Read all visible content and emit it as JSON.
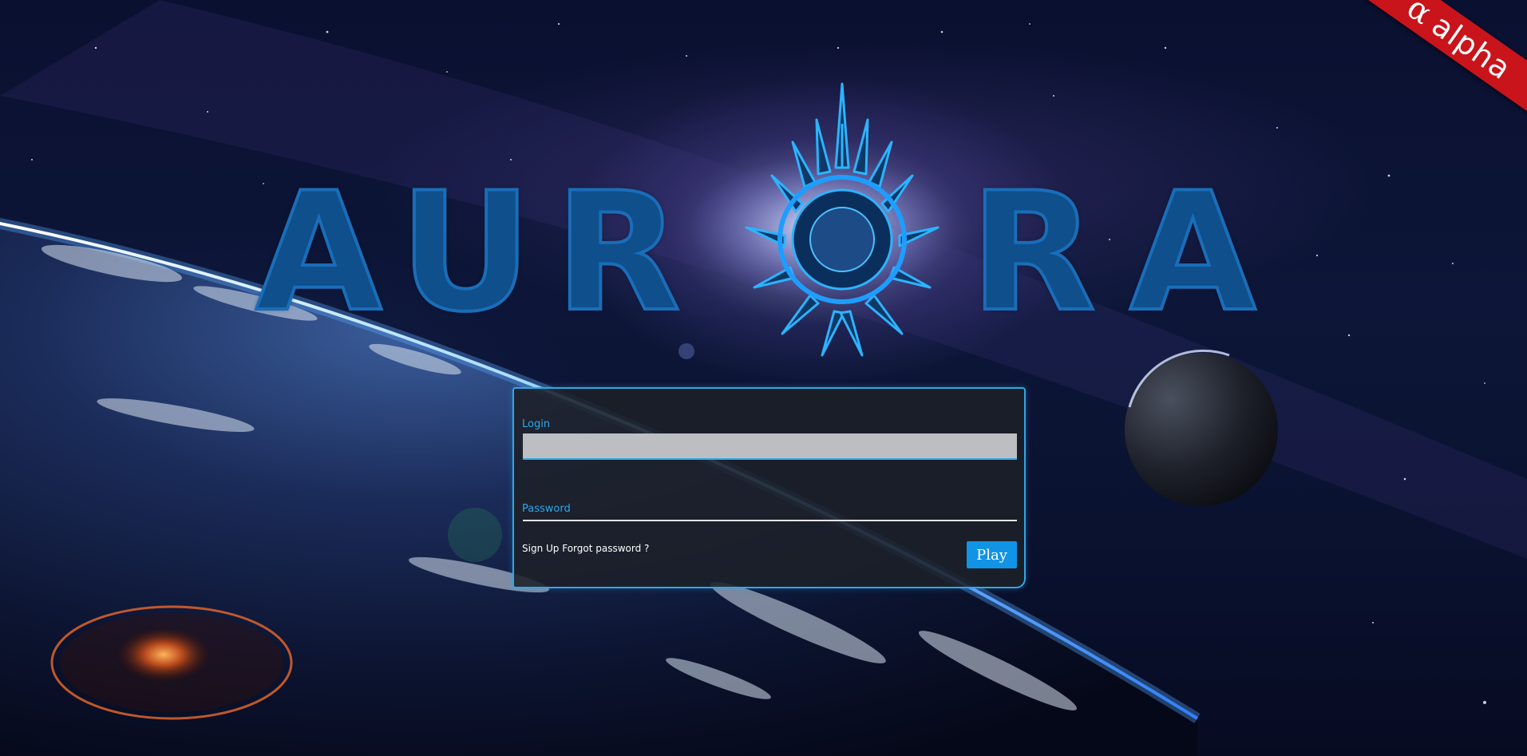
{
  "badge": {
    "alpha_symbol": "α",
    "alpha_text": "alpha"
  },
  "logo": {
    "letters_left": [
      "A",
      "U",
      "R"
    ],
    "letters_right": [
      "R",
      "A"
    ]
  },
  "login_form": {
    "login_label": "Login",
    "login_value": "",
    "password_label": "Password",
    "password_value": "",
    "signup_link": "Sign Up",
    "forgot_link": "Forgot password ?",
    "play_button": "Play"
  },
  "colors": {
    "accent": "#2ea7e8",
    "play_button": "#1193e6",
    "ribbon": "#c8141a",
    "logo_fill": "#0e4f8c"
  },
  "icons": {
    "logo_emblem": "sun-emblem-icon"
  }
}
